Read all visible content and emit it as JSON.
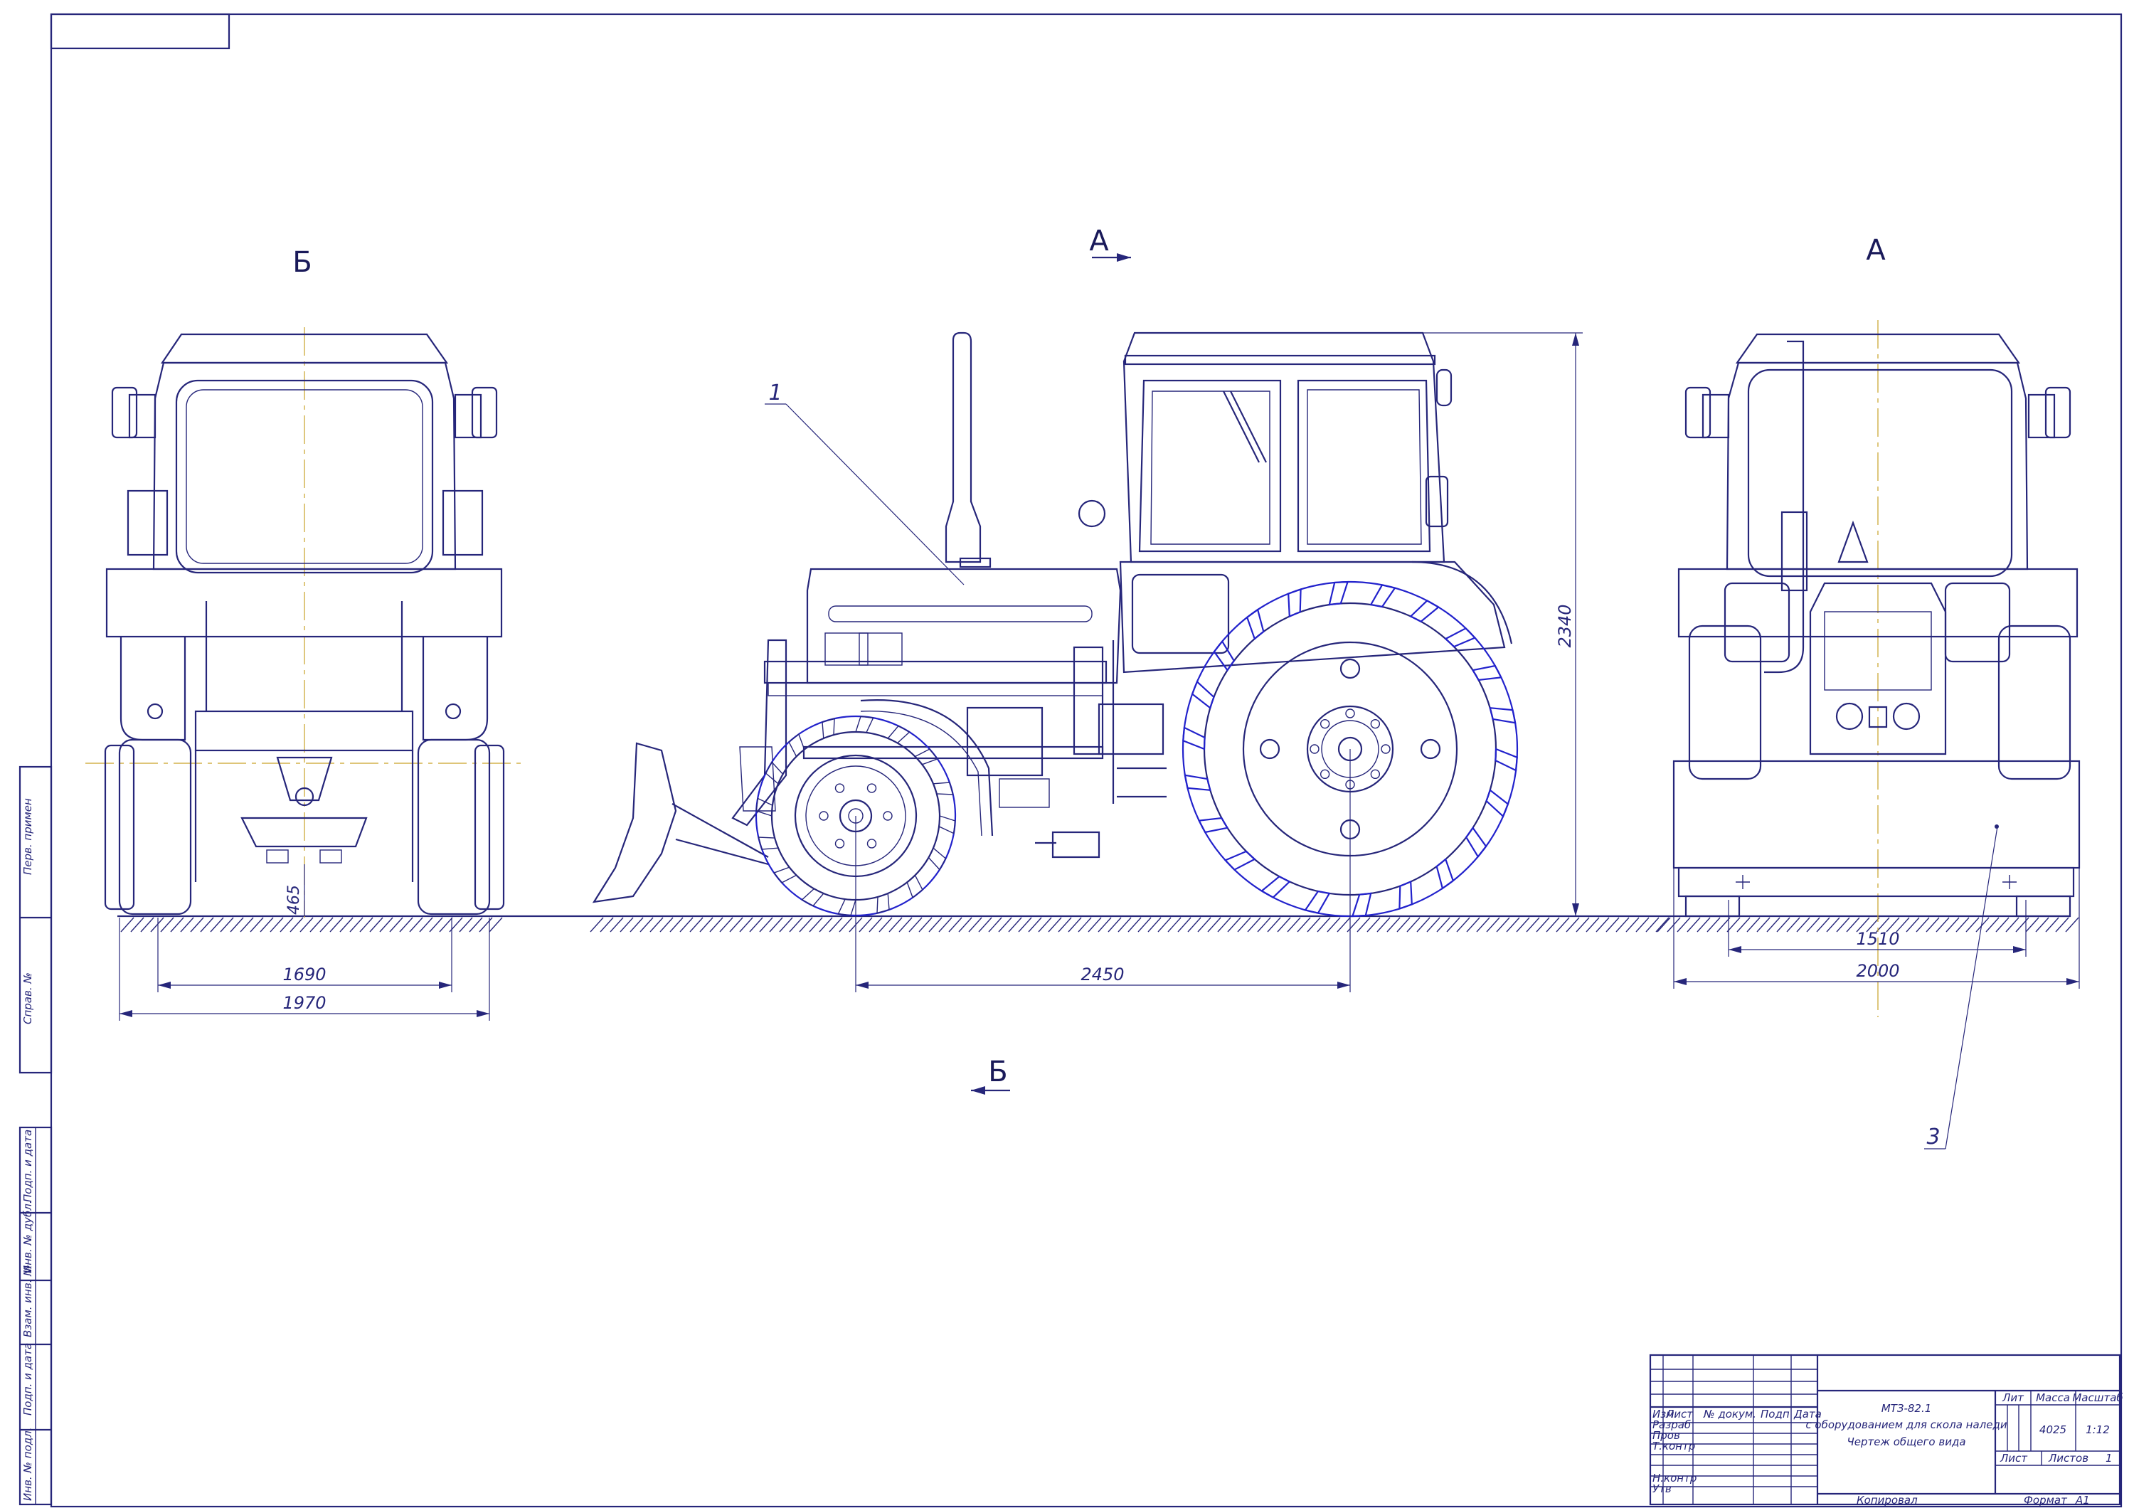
{
  "views": {
    "view_b_label": "Б",
    "section_a_label": "А",
    "view_a_label": "А",
    "section_b_label": "Б"
  },
  "callouts": {
    "item1": "1",
    "item3": "3"
  },
  "dimensions": {
    "track_front": "1690",
    "width_front": "1970",
    "clearance": "465",
    "wheelbase": "2450",
    "height": "2340",
    "track_rear": "1510",
    "width_rear": "2000"
  },
  "side_stamp": {
    "perv_primen": "Перв. примен",
    "sprav_no": "Справ. №",
    "podp_data_1": "Подп. и дата",
    "inv_dubl": "Инв. № дубл.",
    "vzam_inv": "Взам. инв. №",
    "podp_data_2": "Подп. и дата",
    "inv_podl": "Инв. № подл."
  },
  "title_block": {
    "title_line1": "МТЗ-82.1",
    "title_line2": "с оборудованием для скола наледи",
    "title_line3": "Чертеж общего вида",
    "col_izm": "Изм",
    "col_list": "Лист",
    "col_doc": "№ докум.",
    "col_podp": "Подп",
    "col_data": "Дата",
    "row_razrab": "Разраб",
    "row_prov": "Пров",
    "row_tkontr": "Т.контр",
    "row_nkontr": "Н.контр",
    "row_utv": "Утв",
    "hdr_lit": "Лит",
    "hdr_massa": "Масса",
    "hdr_masshtab": "Масштаб",
    "massa": "4025",
    "masshtab": "1:12",
    "list_label": "Лист",
    "listov_label": "Листов",
    "listov": "1",
    "kopiroval": "Копировал",
    "format_label": "Формат",
    "format": "А1"
  }
}
